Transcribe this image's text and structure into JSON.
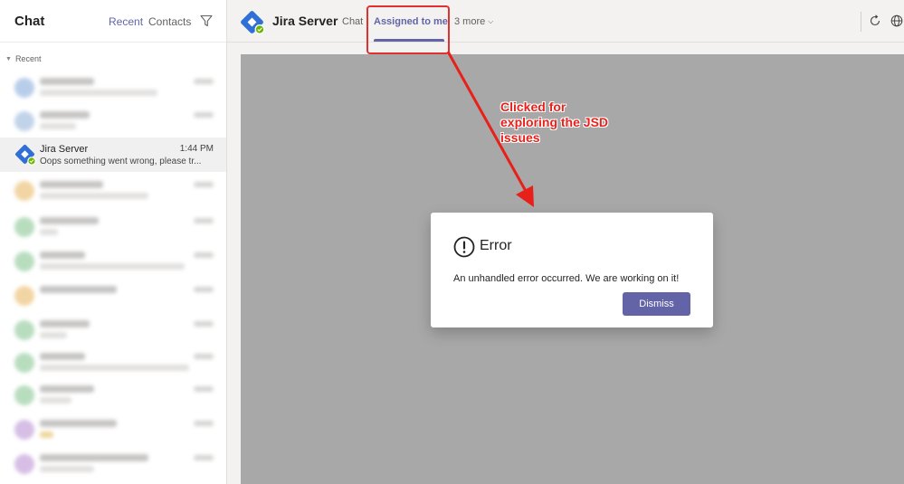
{
  "sidebar": {
    "title": "Chat",
    "tabs": {
      "recent": "Recent",
      "contacts": "Contacts"
    },
    "section_label": "Recent",
    "active_chat": {
      "name": "Jira Server",
      "time": "1:44 PM",
      "preview": "Oops something went wrong, please tr..."
    }
  },
  "header": {
    "app_title": "Jira Server",
    "tabs": {
      "chat": "Chat",
      "assigned": "Assigned to me",
      "more": "3 more"
    }
  },
  "annotation": {
    "line1": "Clicked for",
    "line2": "exploring the JSD",
    "line3": "issues"
  },
  "dialog": {
    "title": "Error",
    "message": "An unhandled error occurred. We are working on it!",
    "dismiss_label": "Dismiss"
  },
  "colors": {
    "accent": "#6264a7",
    "annotation_red": "#e8201a",
    "jira_blue": "#2684ff",
    "status_green": "#6bb700"
  }
}
